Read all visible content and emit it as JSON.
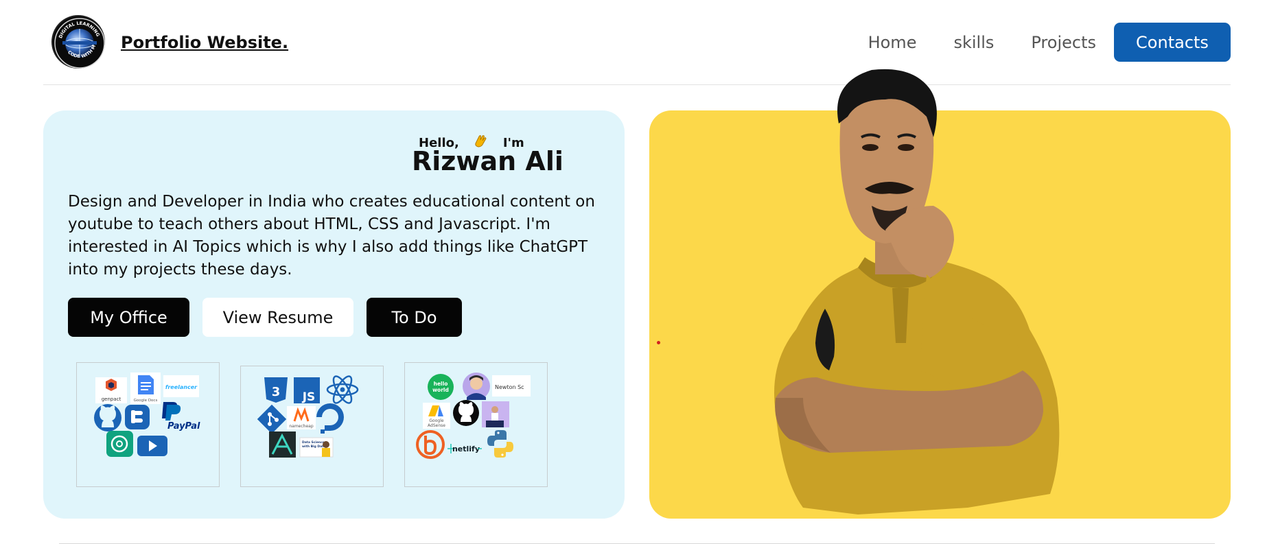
{
  "header": {
    "brand": "Portfolio Website.",
    "logo_text": "DIGITAL LEARNING · CODE WITH ME",
    "nav": [
      "Home",
      "skills",
      "Projects"
    ],
    "cta": "Contacts"
  },
  "intro": {
    "hello": "Hello,",
    "im": "I'm",
    "wave_icon": "waving-hand-icon",
    "name": "Rizwan Ali",
    "bio": "Design and Developer in India who creates educational content on youtube to teach others about HTML, CSS and Javascript. I'm interested in AI Topics which is why I also add things like ChatGPT into my projects these days.",
    "buttons": [
      "My Office",
      "View Resume",
      "To Do"
    ]
  },
  "tiles": {
    "tile1": {
      "icons": [
        "genpact-logo",
        "google-docs-logo",
        "freelancer-logo",
        "github-logo",
        "blogger-logo",
        "paypal-logo",
        "chatgpt-logo",
        "youtube-logo"
      ],
      "labels": {
        "genpact": "genpact",
        "gdocs": "Google Docs",
        "freelancer": "freelancer",
        "paypal": "PayPal"
      }
    },
    "tile2": {
      "icons": [
        "css3-logo",
        "javascript-logo",
        "react-logo",
        "git-logo",
        "namecheap-logo",
        "digitalocean-logo",
        "logo-app-icon",
        "data-science-thumbnail"
      ],
      "labels": {
        "css": "3",
        "js": "JS",
        "namecheap": "namecheap",
        "ds": "Data Science with Big Data"
      }
    },
    "tile3": {
      "icons": [
        "hello-world-logo",
        "avatar-thumbnail",
        "newton-school-logo",
        "google-adsense-logo",
        "github-logo",
        "speaker-thumbnail",
        "bitly-logo",
        "netlify-logo",
        "python-logo"
      ],
      "labels": {
        "hello": "hello world",
        "newton": "Newton Sc",
        "adsense": "Google AdSense",
        "netlify": "netlify"
      }
    }
  },
  "photo": {
    "alt": "portrait-photo"
  },
  "colors": {
    "accent": "#0f5fb1",
    "intro_bg": "#e0f5fb",
    "photo_bg": "#fcd84a"
  }
}
